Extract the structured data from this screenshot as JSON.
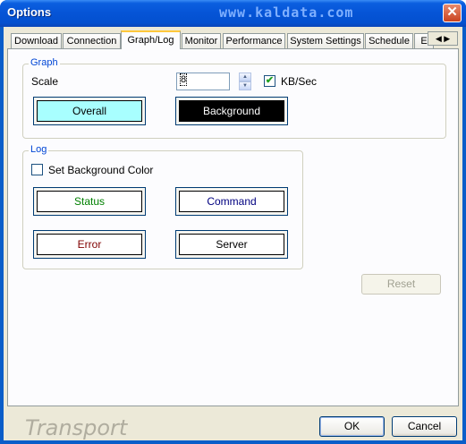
{
  "window": {
    "title": "Options",
    "watermark": "www.kaldata.com",
    "close_label": "✕"
  },
  "tabs": [
    {
      "label": "Download",
      "active": false
    },
    {
      "label": "Connection",
      "active": false
    },
    {
      "label": "Graph/Log",
      "active": true
    },
    {
      "label": "Monitor",
      "active": false
    },
    {
      "label": "Performance",
      "active": false
    },
    {
      "label": "System Settings",
      "active": false
    },
    {
      "label": "Schedule",
      "active": false
    },
    {
      "label": "E",
      "active": false
    }
  ],
  "tab_scroll": {
    "left_icon": "◀",
    "right_icon": "▶"
  },
  "graph": {
    "legend": "Graph",
    "scale_label": "Scale",
    "scale_value": "8",
    "kbsec_label": "KB/Sec",
    "kbsec_checked": true,
    "overall_label": "Overall",
    "overall_color": "#a8ffff",
    "background_label": "Background",
    "background_color": "#000000"
  },
  "log": {
    "legend": "Log",
    "set_bg_label": "Set Background Color",
    "set_bg_checked": false,
    "status_label": "Status",
    "status_color": "#008000",
    "command_label": "Command",
    "command_color": "#000080",
    "error_label": "Error",
    "error_color": "#800000",
    "server_label": "Server",
    "server_color": "#000000"
  },
  "buttons": {
    "reset": "Reset",
    "ok": "OK",
    "cancel": "Cancel"
  },
  "brand": "Transport"
}
